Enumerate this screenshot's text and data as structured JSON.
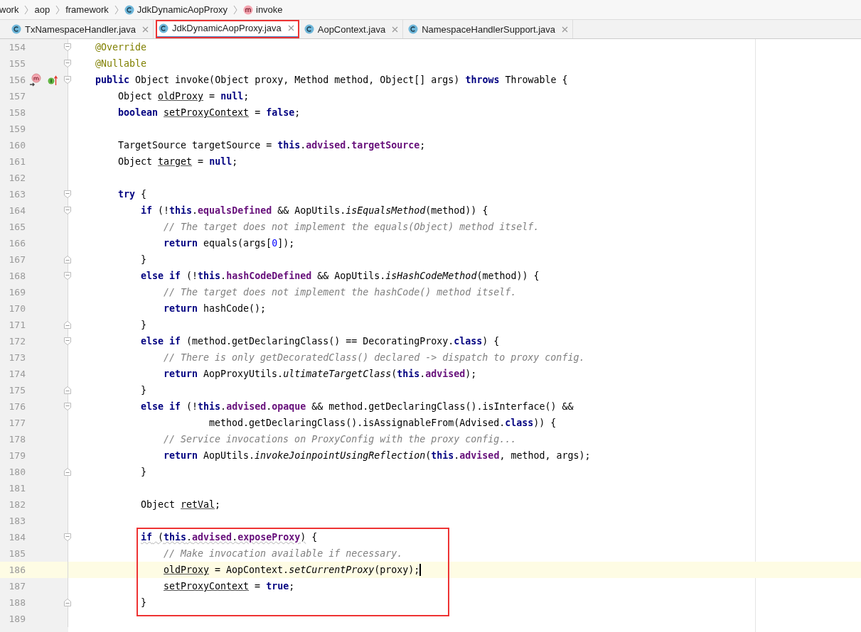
{
  "breadcrumb": [
    {
      "label": "work",
      "kind": "package"
    },
    {
      "label": "aop",
      "kind": "package"
    },
    {
      "label": "framework",
      "kind": "package"
    },
    {
      "label": "JdkDynamicAopProxy",
      "kind": "class"
    },
    {
      "label": "invoke",
      "kind": "method"
    }
  ],
  "tabs": [
    {
      "label": "TxNamespaceHandler.java",
      "selected": false,
      "boxed": false
    },
    {
      "label": "JdkDynamicAopProxy.java",
      "selected": true,
      "boxed": true
    },
    {
      "label": "AopContext.java",
      "selected": false,
      "boxed": false
    },
    {
      "label": "NamespaceHandlerSupport.java",
      "selected": false,
      "boxed": false
    }
  ],
  "lines": [
    {
      "number": "154",
      "fold_start": true,
      "tokens": [
        {
          "text": "@Override",
          "kind": "annotation"
        }
      ]
    },
    {
      "number": "155",
      "fold_start": true,
      "tokens": [
        {
          "text": "@Nullable",
          "kind": "annotation"
        }
      ]
    },
    {
      "number": "156",
      "fold_start": true,
      "overrides": true,
      "implements": true,
      "tokens": [
        {
          "text": "public",
          "kind": "keyword"
        },
        {
          "text": " Object invoke(Object proxy, Method method, Object[] args) ",
          "kind": "plain"
        },
        {
          "text": "throws",
          "kind": "keyword"
        },
        {
          "text": " Throwable {",
          "kind": "plain"
        }
      ],
      "children": [
        {
          "number": "157",
          "tokens": [
            {
              "text": "Object ",
              "kind": "plain"
            },
            {
              "text": "oldProxy",
              "kind": "variable"
            },
            {
              "text": " = ",
              "kind": "plain"
            },
            {
              "text": "null",
              "kind": "keyword"
            },
            {
              "text": ";",
              "kind": "plain"
            }
          ]
        },
        {
          "number": "158",
          "tokens": [
            {
              "text": "boolean ",
              "kind": "keyword"
            },
            {
              "text": "setProxyContext",
              "kind": "variable"
            },
            {
              "text": " = ",
              "kind": "plain"
            },
            {
              "text": "false",
              "kind": "keyword"
            },
            {
              "text": ";",
              "kind": "plain"
            }
          ]
        },
        {
          "number": "159"
        },
        {
          "number": "160",
          "tokens": [
            {
              "text": "TargetSource targetSource = ",
              "kind": "plain"
            },
            {
              "text": "this",
              "kind": "keyword"
            },
            {
              "text": ".",
              "kind": "plain"
            },
            {
              "text": "advised",
              "kind": "field"
            },
            {
              "text": ".",
              "kind": "plain"
            },
            {
              "text": "targetSource",
              "kind": "field"
            },
            {
              "text": ";",
              "kind": "plain"
            }
          ]
        },
        {
          "number": "161",
          "tokens": [
            {
              "text": "Object ",
              "kind": "plain"
            },
            {
              "text": "target",
              "kind": "variable"
            },
            {
              "text": " = ",
              "kind": "plain"
            },
            {
              "text": "null",
              "kind": "keyword"
            },
            {
              "text": ";",
              "kind": "plain"
            }
          ]
        },
        {
          "number": "162"
        },
        {
          "number": "163",
          "fold_start": true,
          "tokens": [
            {
              "text": "try",
              "kind": "keyword"
            },
            {
              "text": " {",
              "kind": "plain"
            }
          ],
          "children": [
            {
              "number": "164",
              "fold_start": true,
              "tokens": [
                {
                  "text": "if",
                  "kind": "keyword"
                },
                {
                  "text": " (!",
                  "kind": "plain"
                },
                {
                  "text": "this",
                  "kind": "keyword"
                },
                {
                  "text": ".",
                  "kind": "plain"
                },
                {
                  "text": "equalsDefined",
                  "kind": "field"
                },
                {
                  "text": " && AopUtils.",
                  "kind": "plain"
                },
                {
                  "text": "isEqualsMethod",
                  "kind": "static"
                },
                {
                  "text": "(method)) {",
                  "kind": "plain"
                }
              ],
              "children": [
                {
                  "number": "165",
                  "tokens": [
                    {
                      "text": "// The target does not implement the equals(Object) method itself.",
                      "kind": "comment"
                    }
                  ]
                },
                {
                  "number": "166",
                  "tokens": [
                    {
                      "text": "return",
                      "kind": "keyword"
                    },
                    {
                      "text": " equals(args[",
                      "kind": "plain"
                    },
                    {
                      "text": "0",
                      "kind": "number"
                    },
                    {
                      "text": "]);",
                      "kind": "plain"
                    }
                  ]
                }
              ]
            },
            {
              "number": "167",
              "fold_end": true,
              "tokens": [
                {
                  "text": "}",
                  "kind": "plain"
                }
              ]
            },
            {
              "number": "168",
              "fold_start": true,
              "tokens": [
                {
                  "text": "else if",
                  "kind": "keyword"
                },
                {
                  "text": " (!",
                  "kind": "plain"
                },
                {
                  "text": "this",
                  "kind": "keyword"
                },
                {
                  "text": ".",
                  "kind": "plain"
                },
                {
                  "text": "hashCodeDefined",
                  "kind": "field"
                },
                {
                  "text": " && AopUtils.",
                  "kind": "plain"
                },
                {
                  "text": "isHashCodeMethod",
                  "kind": "static"
                },
                {
                  "text": "(method)) {",
                  "kind": "plain"
                }
              ],
              "children": [
                {
                  "number": "169",
                  "tokens": [
                    {
                      "text": "// The target does not implement the hashCode() method itself.",
                      "kind": "comment"
                    }
                  ]
                },
                {
                  "number": "170",
                  "tokens": [
                    {
                      "text": "return",
                      "kind": "keyword"
                    },
                    {
                      "text": " hashCode();",
                      "kind": "plain"
                    }
                  ]
                }
              ]
            },
            {
              "number": "171",
              "fold_end": true,
              "tokens": [
                {
                  "text": "}",
                  "kind": "plain"
                }
              ]
            },
            {
              "number": "172",
              "fold_start": true,
              "tokens": [
                {
                  "text": "else if",
                  "kind": "keyword"
                },
                {
                  "text": " (method.getDeclaringClass() == DecoratingProxy.",
                  "kind": "plain"
                },
                {
                  "text": "class",
                  "kind": "keyword"
                },
                {
                  "text": ") {",
                  "kind": "plain"
                }
              ],
              "children": [
                {
                  "number": "173",
                  "tokens": [
                    {
                      "text": "// There is only getDecoratedClass() declared -> dispatch to proxy config.",
                      "kind": "comment"
                    }
                  ]
                },
                {
                  "number": "174",
                  "tokens": [
                    {
                      "text": "return",
                      "kind": "keyword"
                    },
                    {
                      "text": " AopProxyUtils.",
                      "kind": "plain"
                    },
                    {
                      "text": "ultimateTargetClass",
                      "kind": "static"
                    },
                    {
                      "text": "(",
                      "kind": "plain"
                    },
                    {
                      "text": "this",
                      "kind": "keyword"
                    },
                    {
                      "text": ".",
                      "kind": "plain"
                    },
                    {
                      "text": "advised",
                      "kind": "field"
                    },
                    {
                      "text": ");",
                      "kind": "plain"
                    }
                  ]
                }
              ]
            },
            {
              "number": "175",
              "fold_end": true,
              "tokens": [
                {
                  "text": "}",
                  "kind": "plain"
                }
              ]
            },
            {
              "number": "176",
              "fold_start": true,
              "tokens": [
                {
                  "text": "else if",
                  "kind": "keyword"
                },
                {
                  "text": " (!",
                  "kind": "plain"
                },
                {
                  "text": "this",
                  "kind": "keyword"
                },
                {
                  "text": ".",
                  "kind": "plain"
                },
                {
                  "text": "advised",
                  "kind": "field"
                },
                {
                  "text": ".",
                  "kind": "plain"
                },
                {
                  "text": "opaque",
                  "kind": "field"
                },
                {
                  "text": " && method.getDeclaringClass().isInterface() &&",
                  "kind": "plain"
                }
              ],
              "children": [
                {
                  "number": "177",
                  "continuation": true,
                  "tokens": [
                    {
                      "text": "method.getDeclaringClass().isAssignableFrom(Advised.",
                      "kind": "plain"
                    },
                    {
                      "text": "class",
                      "kind": "keyword"
                    },
                    {
                      "text": ")) {",
                      "kind": "plain"
                    }
                  ]
                },
                {
                  "number": "178",
                  "tokens": [
                    {
                      "text": "// Service invocations on ProxyConfig with the proxy config...",
                      "kind": "comment"
                    }
                  ]
                },
                {
                  "number": "179",
                  "tokens": [
                    {
                      "text": "return",
                      "kind": "keyword"
                    },
                    {
                      "text": " AopUtils.",
                      "kind": "plain"
                    },
                    {
                      "text": "invokeJoinpointUsingReflection",
                      "kind": "static"
                    },
                    {
                      "text": "(",
                      "kind": "plain"
                    },
                    {
                      "text": "this",
                      "kind": "keyword"
                    },
                    {
                      "text": ".",
                      "kind": "plain"
                    },
                    {
                      "text": "advised",
                      "kind": "field"
                    },
                    {
                      "text": ", method, args);",
                      "kind": "plain"
                    }
                  ]
                }
              ]
            },
            {
              "number": "180",
              "fold_end": true,
              "tokens": [
                {
                  "text": "}",
                  "kind": "plain"
                }
              ]
            },
            {
              "number": "181"
            },
            {
              "number": "182",
              "tokens": [
                {
                  "text": "Object ",
                  "kind": "plain"
                },
                {
                  "text": "retVal",
                  "kind": "variable"
                },
                {
                  "text": ";",
                  "kind": "plain"
                }
              ]
            },
            {
              "number": "183"
            },
            {
              "number": "184",
              "fold_start": true,
              "boxed": true,
              "tokens": [
                {
                  "text": "if",
                  "kind": "keyword",
                  "warning": true
                },
                {
                  "text": " (",
                  "kind": "plain",
                  "warning": true
                },
                {
                  "text": "this",
                  "kind": "keyword",
                  "warning": true
                },
                {
                  "text": ".",
                  "kind": "plain",
                  "warning": true
                },
                {
                  "text": "advised",
                  "kind": "field",
                  "warning": true
                },
                {
                  "text": ".",
                  "kind": "plain",
                  "warning": true
                },
                {
                  "text": "exposeProxy",
                  "kind": "field",
                  "warning": true
                },
                {
                  "text": ")",
                  "kind": "plain",
                  "warning": true
                },
                {
                  "text": " {",
                  "kind": "plain"
                }
              ],
              "children": [
                {
                  "number": "185",
                  "boxed": true,
                  "tokens": [
                    {
                      "text": "// Make invocation available if necessary.",
                      "kind": "comment"
                    }
                  ]
                },
                {
                  "number": "186",
                  "boxed": true,
                  "current": true,
                  "tokens": [
                    {
                      "text": "oldProxy",
                      "kind": "variable"
                    },
                    {
                      "text": " = AopContext.",
                      "kind": "plain"
                    },
                    {
                      "text": "setCurrentProxy",
                      "kind": "static"
                    },
                    {
                      "text": "(proxy);",
                      "kind": "plain"
                    }
                  ]
                },
                {
                  "number": "187",
                  "boxed": true,
                  "tokens": [
                    {
                      "text": "setProxyContext",
                      "kind": "variable"
                    },
                    {
                      "text": " = ",
                      "kind": "plain"
                    },
                    {
                      "text": "true",
                      "kind": "keyword"
                    },
                    {
                      "text": ";",
                      "kind": "plain"
                    }
                  ]
                }
              ]
            },
            {
              "number": "188",
              "fold_end": true,
              "boxed": true,
              "tokens": [
                {
                  "text": "}",
                  "kind": "plain"
                }
              ]
            },
            {
              "number": "189"
            }
          ]
        }
      ]
    }
  ]
}
